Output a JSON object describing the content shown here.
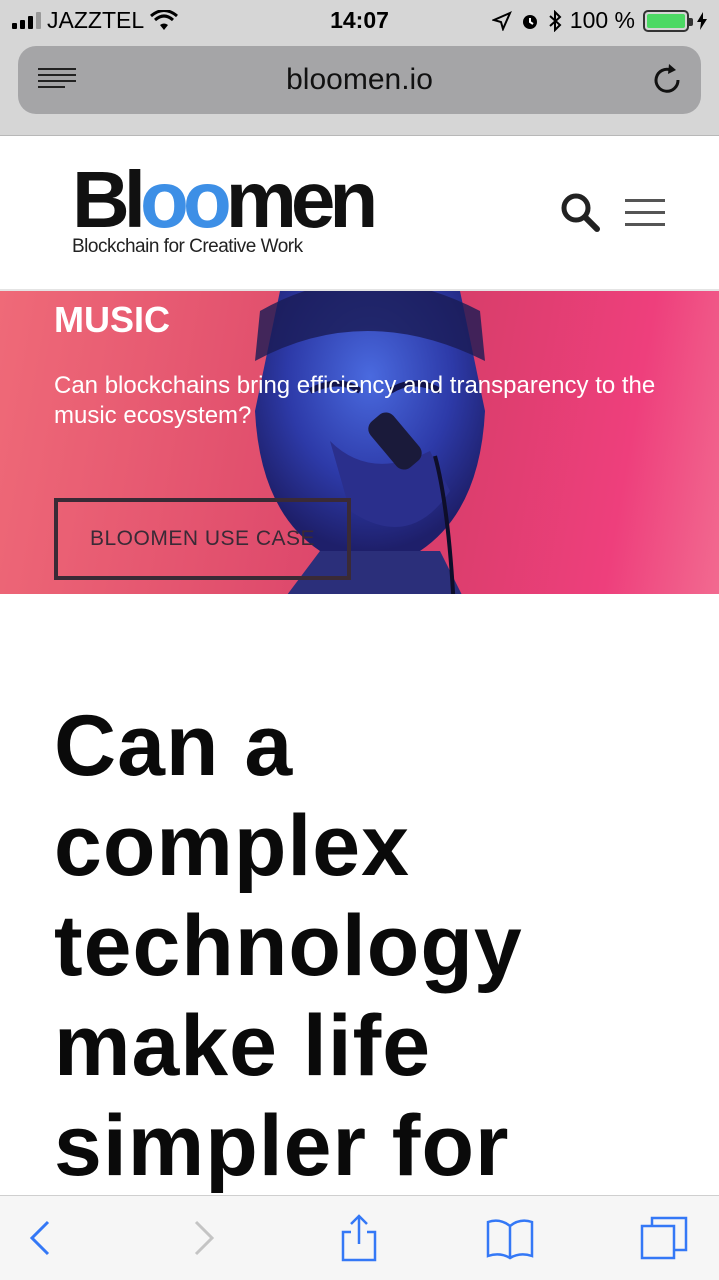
{
  "status_bar": {
    "carrier": "JAZZTEL",
    "time": "14:07",
    "battery_percent": "100 %",
    "battery_level": 1.0,
    "icons": [
      "signal-icon",
      "wifi-icon",
      "location-icon",
      "alarm-icon",
      "bluetooth-icon",
      "battery-icon",
      "charging-icon"
    ]
  },
  "browser": {
    "url": "bloomen.io",
    "icons": [
      "reader-view-icon",
      "reload-icon"
    ]
  },
  "site_header": {
    "logo_text": "Bloomen",
    "logo_tagline": "Blockchain for Creative Work",
    "brand_color": "#3d8fe6",
    "icons": [
      "search-icon",
      "hamburger-menu-icon"
    ]
  },
  "hero": {
    "category": "MUSIC",
    "description": "Can blockchains bring efficiency and transparency to the music ecosystem?",
    "cta_label": "BLOOMEN USE CASE",
    "accent_color": "#e2516e"
  },
  "article": {
    "headline_lines": [
      "Can a",
      "complex",
      "technology",
      "make life",
      "simpler for"
    ]
  },
  "toolbar": {
    "icons": [
      "back-icon",
      "forward-icon",
      "share-icon",
      "bookmarks-icon",
      "tabs-icon"
    ],
    "icon_color": "#3478f6"
  }
}
